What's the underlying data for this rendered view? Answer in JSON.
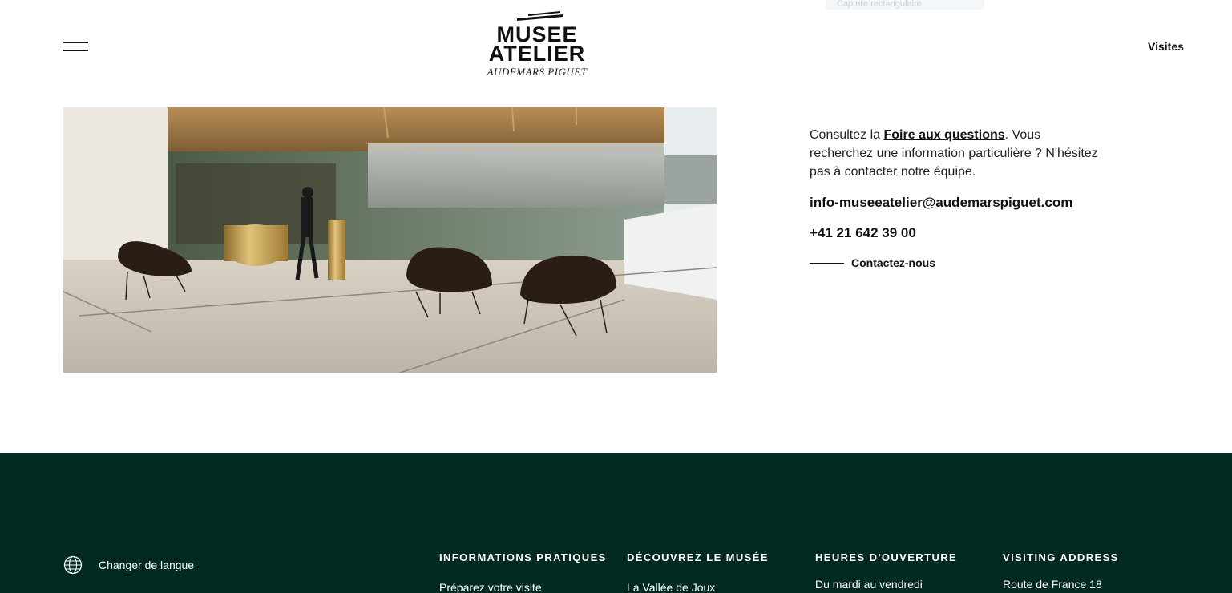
{
  "overlay": {
    "tooltip_text": "Capture rectangulaire"
  },
  "header": {
    "logo": {
      "line1": "MUSEE",
      "line2": "ATELIER",
      "line3": "AUDEMARS PIGUET"
    },
    "nav_visits": "Visites",
    "menu_icon": "hamburger-icon"
  },
  "contact_section": {
    "text_before_link": "Consultez la ",
    "faq_link": "Foire aux questions",
    "text_after_link": ". Vous recherchez une information particulière ? N'hésitez pas à contacter notre équipe.",
    "email": "info-museeatelier@audemarspiguet.com",
    "phone": "+41 21 642 39 00",
    "contact_link": "Contactez-nous"
  },
  "footer": {
    "background_color": "#022a21",
    "language": {
      "icon": "globe-icon",
      "label": "Changer de langue"
    },
    "columns": [
      {
        "heading": "INFORMATIONS PRATIQUES",
        "first_item": "Préparez votre visite"
      },
      {
        "heading": "DÉCOUVREZ LE MUSÉE",
        "first_item": "La Vallée de Joux"
      },
      {
        "heading": "HEURES D'OUVERTURE",
        "first_item": "Du mardi au vendredi"
      },
      {
        "heading": "VISITING ADDRESS",
        "first_item": "Route de France 18"
      }
    ]
  }
}
